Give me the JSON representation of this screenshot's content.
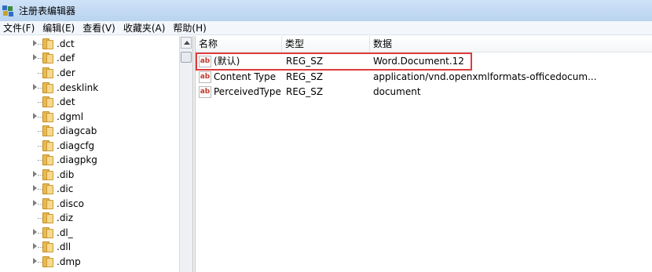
{
  "window": {
    "title": "注册表编辑器",
    "icon": "regedit-icon"
  },
  "menu": [
    {
      "label": "文件(F)"
    },
    {
      "label": "编辑(E)"
    },
    {
      "label": "查看(V)"
    },
    {
      "label": "收藏夹(A)"
    },
    {
      "label": "帮助(H)"
    }
  ],
  "tree": {
    "items": [
      {
        "label": ".dct",
        "expandable": true
      },
      {
        "label": ".def",
        "expandable": true
      },
      {
        "label": ".der",
        "expandable": false
      },
      {
        "label": ".desklink",
        "expandable": true
      },
      {
        "label": ".det",
        "expandable": false
      },
      {
        "label": ".dgml",
        "expandable": true
      },
      {
        "label": ".diagcab",
        "expandable": false
      },
      {
        "label": ".diagcfg",
        "expandable": false
      },
      {
        "label": ".diagpkg",
        "expandable": false
      },
      {
        "label": ".dib",
        "expandable": true
      },
      {
        "label": ".dic",
        "expandable": true
      },
      {
        "label": ".disco",
        "expandable": true
      },
      {
        "label": ".diz",
        "expandable": false
      },
      {
        "label": ".dl_",
        "expandable": true
      },
      {
        "label": ".dll",
        "expandable": true
      },
      {
        "label": ".dmp",
        "expandable": true
      }
    ]
  },
  "list": {
    "columns": [
      {
        "label": "名称"
      },
      {
        "label": "类型"
      },
      {
        "label": "数据"
      }
    ],
    "rows": [
      {
        "name": "(默认)",
        "type": "REG_SZ",
        "data": "Word.Document.12",
        "icon": "ab"
      },
      {
        "name": "Content Type",
        "type": "REG_SZ",
        "data": "application/vnd.openxmlformats-officedocum...",
        "icon": "ab"
      },
      {
        "name": "PerceivedType",
        "type": "REG_SZ",
        "data": "document",
        "icon": "ab"
      }
    ]
  },
  "colors": {
    "highlight_border": "#e03b3b",
    "folder": "#e9b94f"
  }
}
